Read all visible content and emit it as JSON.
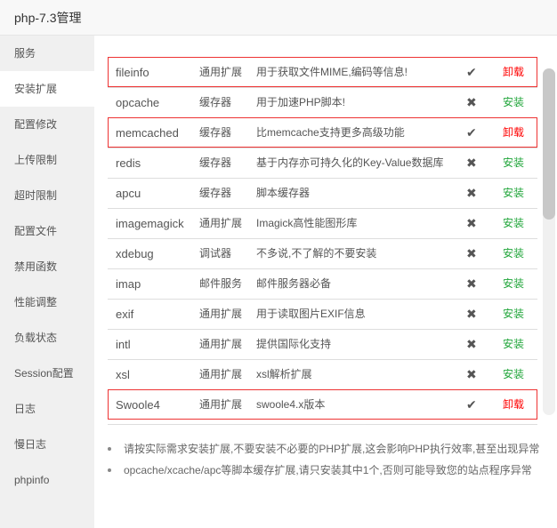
{
  "title": "php-7.3管理",
  "sidebar": {
    "active": 1,
    "items": [
      "服务",
      "安装扩展",
      "配置修改",
      "上传限制",
      "超时限制",
      "配置文件",
      "禁用函数",
      "性能调整",
      "负载状态",
      "Session配置",
      "日志",
      "慢日志",
      "phpinfo"
    ]
  },
  "extensions": [
    {
      "name": "fileinfo",
      "type": "通用扩展",
      "desc": "用于获取文件MIME,编码等信息!",
      "installed": true,
      "action": "卸载",
      "highlighted": true
    },
    {
      "name": "opcache",
      "type": "缓存器",
      "desc": "用于加速PHP脚本!",
      "installed": false,
      "action": "安装"
    },
    {
      "name": "memcached",
      "type": "缓存器",
      "desc": "比memcache支持更多高级功能",
      "installed": true,
      "action": "卸载",
      "highlighted": true
    },
    {
      "name": "redis",
      "type": "缓存器",
      "desc": "基于内存亦可持久化的Key-Value数据库",
      "installed": false,
      "action": "安装"
    },
    {
      "name": "apcu",
      "type": "缓存器",
      "desc": "脚本缓存器",
      "installed": false,
      "action": "安装"
    },
    {
      "name": "imagemagick",
      "type": "通用扩展",
      "desc": "Imagick高性能图形库",
      "installed": false,
      "action": "安装"
    },
    {
      "name": "xdebug",
      "type": "调试器",
      "desc": "不多说,不了解的不要安装",
      "installed": false,
      "action": "安装"
    },
    {
      "name": "imap",
      "type": "邮件服务",
      "desc": "邮件服务器必备",
      "installed": false,
      "action": "安装"
    },
    {
      "name": "exif",
      "type": "通用扩展",
      "desc": "用于读取图片EXIF信息",
      "installed": false,
      "action": "安装"
    },
    {
      "name": "intl",
      "type": "通用扩展",
      "desc": "提供国际化支持",
      "installed": false,
      "action": "安装"
    },
    {
      "name": "xsl",
      "type": "通用扩展",
      "desc": "xsl解析扩展",
      "installed": false,
      "action": "安装"
    },
    {
      "name": "Swoole4",
      "type": "通用扩展",
      "desc": "swoole4.x版本",
      "installed": true,
      "action": "卸载",
      "highlighted": true
    }
  ],
  "icons": {
    "installed": "check-icon",
    "not_installed": "cross-icon"
  },
  "colors": {
    "install": "#20a53a",
    "uninstall": "#ff0000",
    "highlight": "#ee3333"
  },
  "notes": [
    "请按实际需求安装扩展,不要安装不必要的PHP扩展,这会影响PHP执行效率,甚至出现异常",
    "opcache/xcache/apc等脚本缓存扩展,请只安装其中1个,否则可能导致您的站点程序异常"
  ]
}
